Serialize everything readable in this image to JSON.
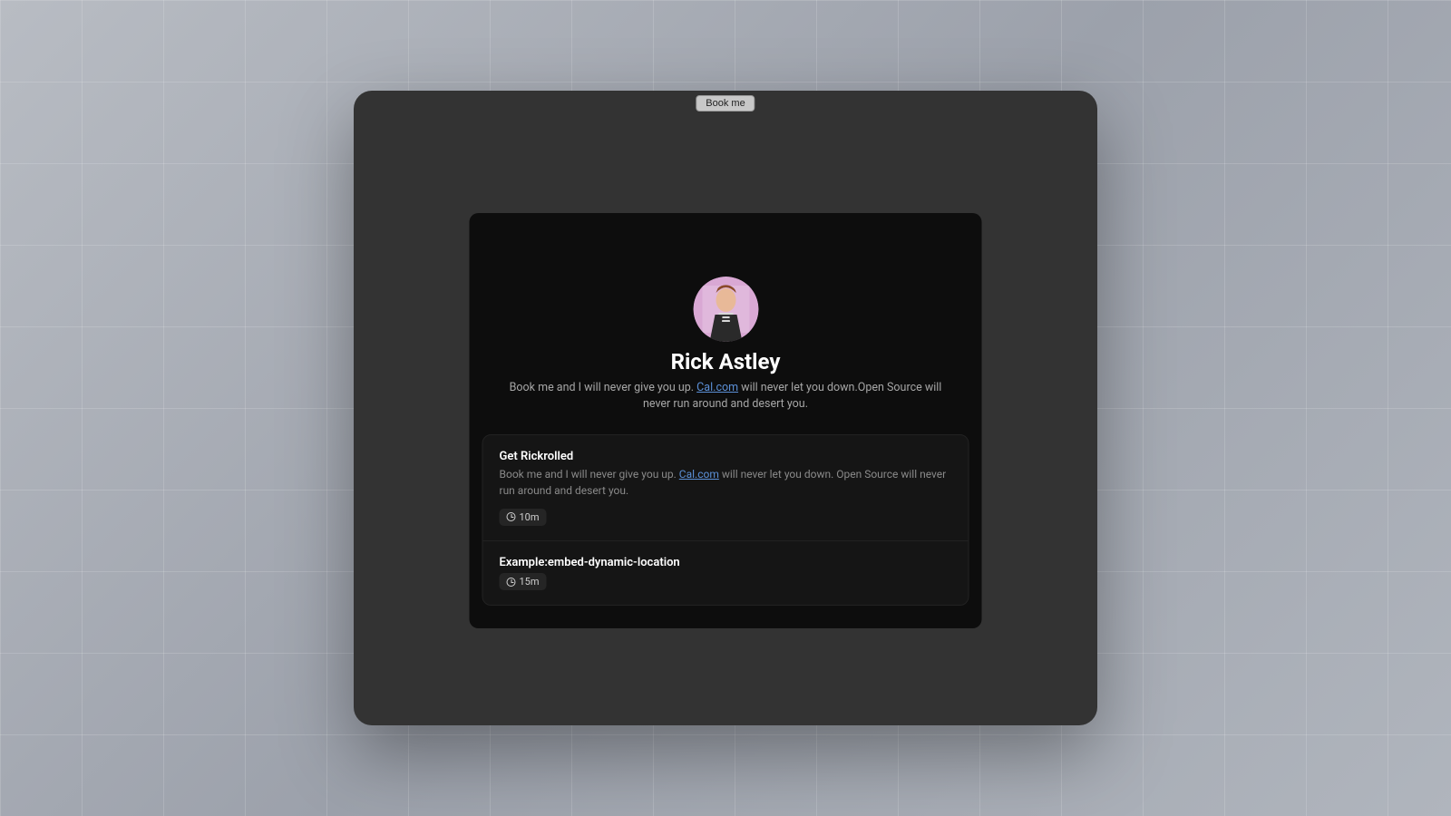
{
  "outer_button": "Book me",
  "profile": {
    "name": "Rick Astley",
    "bio_pre": "Book me and I will never give you up. ",
    "bio_link": "Cal.com",
    "bio_post": " will never let you down.Open Source will never run around and desert you."
  },
  "events": [
    {
      "title": "Get Rickrolled",
      "desc_pre": "Book me and I will never give you up. ",
      "desc_link": "Cal.com",
      "desc_post": " will never let you down. Open Source will never run around and desert you.",
      "duration": "10m"
    },
    {
      "title": "Example:embed-dynamic-location",
      "desc_pre": "",
      "desc_link": "",
      "desc_post": "",
      "duration": "15m"
    }
  ]
}
